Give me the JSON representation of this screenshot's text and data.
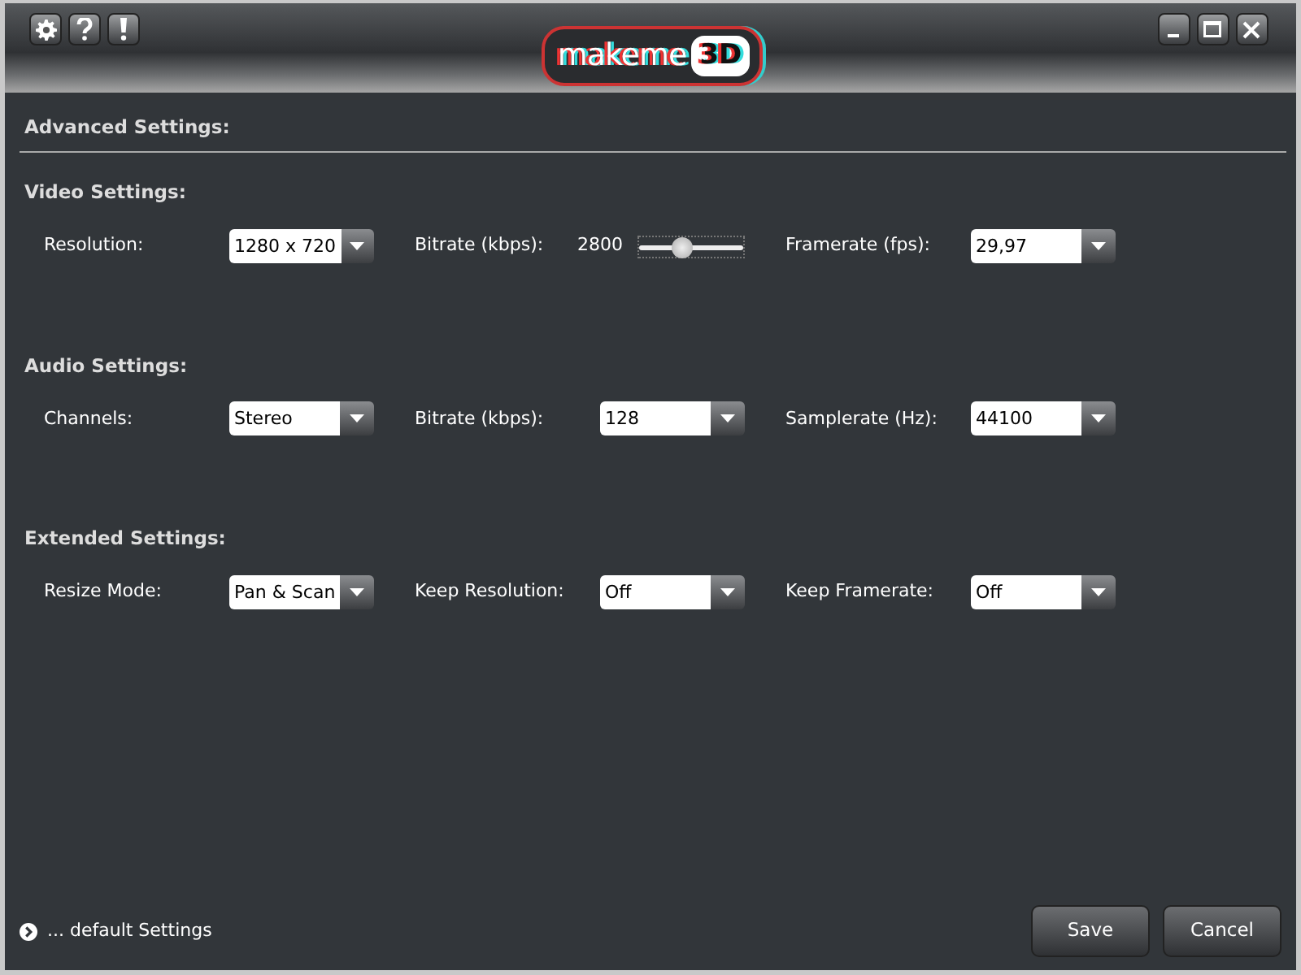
{
  "title_bar": {
    "logo": {
      "word": "makeme",
      "badge": "3D"
    }
  },
  "heading": "Advanced Settings:",
  "sections": [
    {
      "title": "Video Settings:",
      "fields": [
        {
          "label": "Resolution:",
          "kind": "dropdown",
          "value": "1280 x 720"
        },
        {
          "label": "Bitrate (kbps):",
          "kind": "slider",
          "reading": "2800",
          "level": 0.4
        },
        {
          "label": "Framerate (fps):",
          "kind": "dropdown",
          "value": "29,97"
        }
      ]
    },
    {
      "title": "Audio Settings:",
      "fields": [
        {
          "label": "Channels:",
          "kind": "dropdown",
          "value": "Stereo"
        },
        {
          "label": "Bitrate (kbps):",
          "kind": "dropdown",
          "value": "128"
        },
        {
          "label": "Samplerate (Hz):",
          "kind": "dropdown",
          "value": "44100"
        }
      ]
    },
    {
      "title": "Extended Settings:",
      "fields": [
        {
          "label": "Resize Mode:",
          "kind": "dropdown",
          "value": "Pan & Scan"
        },
        {
          "label": "Keep Resolution:",
          "kind": "dropdown",
          "value": "Off"
        },
        {
          "label": "Keep Framerate:",
          "kind": "dropdown",
          "value": "Off"
        }
      ]
    }
  ],
  "footer": {
    "link": "... default Settings",
    "buttons": [
      "Save",
      "Cancel"
    ]
  }
}
